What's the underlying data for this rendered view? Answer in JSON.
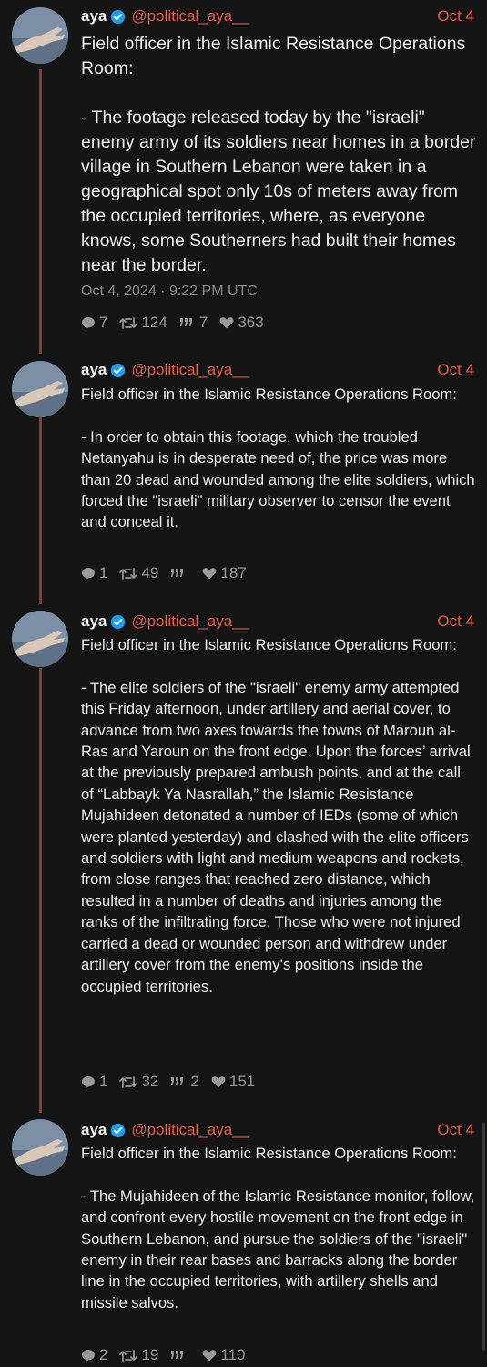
{
  "colors": {
    "background": "#151515",
    "accent": "#e0604f",
    "thread_line": "#8e3b35",
    "verified": "#1d9bf0",
    "muted": "#9a9a9a"
  },
  "tweets": [
    {
      "name": "aya",
      "handle": "@political_aya__",
      "date": "Oct 4",
      "text": "Field officer in the Islamic Resistance Operations Room:\n\n- The footage released today by the \"israeli\" enemy army of its soldiers near homes in a border village in Southern Lebanon were taken in a geographical spot only 10s of meters away from the occupied territories, where, as everyone knows, some Southerners had built their homes near the border.",
      "timestamp": "Oct 4, 2024 · 9:22 PM UTC",
      "replies": "7",
      "retweets": "124",
      "quotes": "7",
      "likes": "363"
    },
    {
      "name": "aya",
      "handle": "@political_aya__",
      "date": "Oct 4",
      "text": "Field officer in the Islamic Resistance Operations Room:\n\n- In order to obtain this footage, which the troubled Netanyahu is in desperate need of, the price was more than 20 dead and wounded among the elite soldiers, which forced the \"israeli\" military observer to censor the event and conceal it.",
      "replies": "1",
      "retweets": "49",
      "quotes": "",
      "likes": "187"
    },
    {
      "name": "aya",
      "handle": "@political_aya__",
      "date": "Oct 4",
      "text": "Field officer in the Islamic Resistance Operations Room:\n\n- The elite soldiers of the \"israeli\" enemy army attempted this Friday afternoon, under artillery and aerial cover, to advance from two axes towards the towns of Maroun al-Ras and Yaroun on the front edge. Upon the forces’ arrival at the previously prepared ambush points, and at the call of “Labbayk Ya Nasrallah,” the Islamic Resistance Mujahideen detonated a number of IEDs (some of which were planted yesterday) and clashed with the elite officers and soldiers with light and medium weapons and rockets, from close ranges that reached zero distance, which resulted in a number of deaths and injuries among the ranks of the infiltrating force. Those who were not injured carried a dead or wounded person and withdrew under artillery cover from the enemy’s positions inside the occupied territories.",
      "replies": "1",
      "retweets": "32",
      "quotes": "2",
      "likes": "151"
    },
    {
      "name": "aya",
      "handle": "@political_aya__",
      "date": "Oct 4",
      "text": "Field officer in the Islamic Resistance Operations Room:\n\n- The Mujahideen of the Islamic Resistance monitor, follow, and confront every hostile movement on the front edge in Southern Lebanon, and pursue the soldiers of the \"israeli\" enemy in their rear bases and barracks along the border line in the occupied territories, with artillery shells and missile salvos.",
      "replies": "2",
      "retweets": "19",
      "quotes": "",
      "likes": "110"
    }
  ]
}
